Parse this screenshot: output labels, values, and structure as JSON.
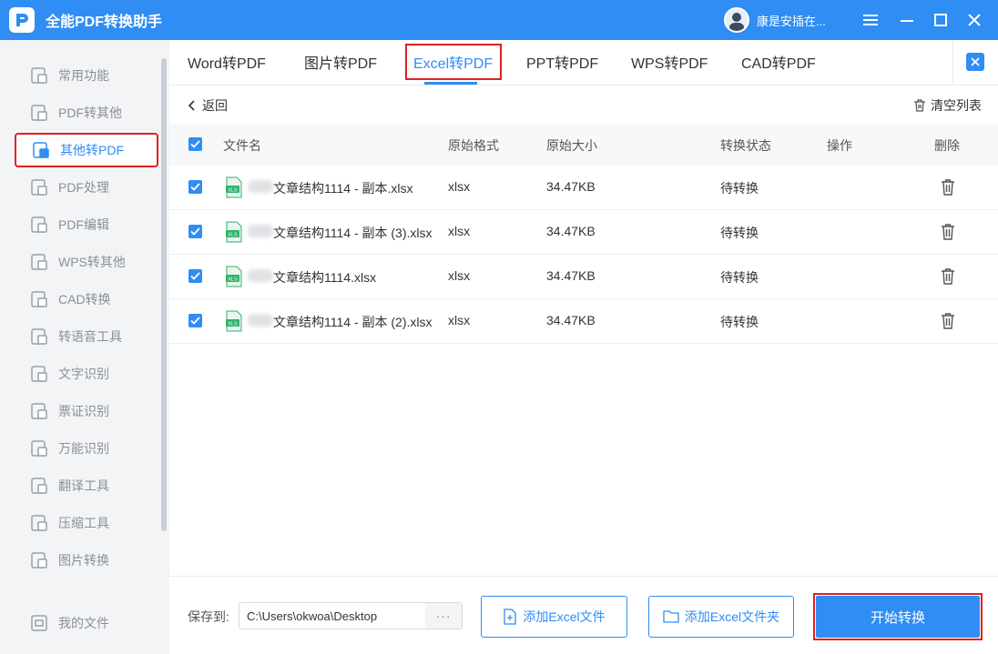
{
  "app": {
    "title": "全能PDF转换助手",
    "user_name": "康是安插在..."
  },
  "sidebar": {
    "items": [
      {
        "label": "常用功能",
        "icon": "common-tools-icon"
      },
      {
        "label": "PDF转其他",
        "icon": "pdf-convert-icon"
      },
      {
        "label": "其他转PDF",
        "icon": "to-pdf-icon",
        "active": true
      },
      {
        "label": "PDF处理",
        "icon": "pdf-process-icon"
      },
      {
        "label": "PDF编辑",
        "icon": "pdf-edit-icon"
      },
      {
        "label": "WPS转其他",
        "icon": "wps-icon"
      },
      {
        "label": "CAD转换",
        "icon": "cad-icon"
      },
      {
        "label": "转语音工具",
        "icon": "voice-icon"
      },
      {
        "label": "文字识别",
        "icon": "ocr-icon"
      },
      {
        "label": "票证识别",
        "icon": "ticket-icon"
      },
      {
        "label": "万能识别",
        "icon": "universal-icon"
      },
      {
        "label": "翻译工具",
        "icon": "translate-icon"
      },
      {
        "label": "压缩工具",
        "icon": "compress-icon"
      },
      {
        "label": "图片转换",
        "icon": "image-convert-icon"
      }
    ],
    "my_files": "我的文件"
  },
  "tabs": [
    {
      "label": "Word转PDF"
    },
    {
      "label": "图片转PDF"
    },
    {
      "label": "Excel转PDF",
      "active": true
    },
    {
      "label": "PPT转PDF"
    },
    {
      "label": "WPS转PDF"
    },
    {
      "label": "CAD转PDF"
    }
  ],
  "toolbar": {
    "back_label": "返回",
    "clear_label": "清空列表"
  },
  "table": {
    "headers": {
      "name": "文件名",
      "format": "原始格式",
      "size": "原始大小",
      "status": "转换状态",
      "action": "操作",
      "delete": "删除"
    },
    "rows": [
      {
        "name": "文章结构1114 - 副本.xlsx",
        "format": "xlsx",
        "size": "34.47KB",
        "status": "待转换"
      },
      {
        "name": "文章结构1114 - 副本 (3).xlsx",
        "format": "xlsx",
        "size": "34.47KB",
        "status": "待转换"
      },
      {
        "name": "文章结构1114.xlsx",
        "format": "xlsx",
        "size": "34.47KB",
        "status": "待转换"
      },
      {
        "name": "文章结构1114 - 副本 (2).xlsx",
        "format": "xlsx",
        "size": "34.47KB",
        "status": "待转换"
      }
    ]
  },
  "footer": {
    "save_label": "保存到:",
    "path": "C:\\Users\\okwoa\\Desktop",
    "more": "···",
    "add_file": "添加Excel文件",
    "add_folder": "添加Excel文件夹",
    "start": "开始转换"
  },
  "colors": {
    "accent": "#2f8df3",
    "highlight": "#e02020"
  }
}
